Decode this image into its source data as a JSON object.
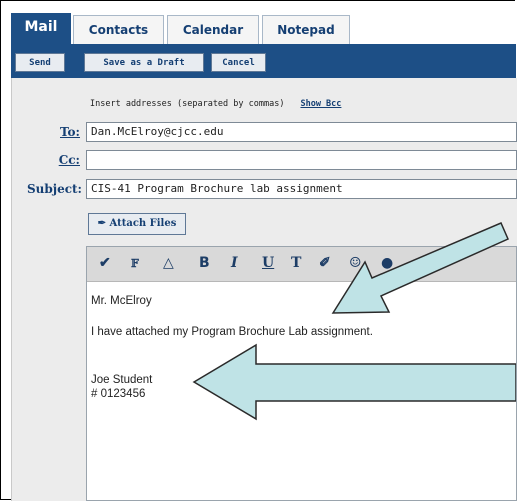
{
  "tabs": [
    {
      "label": "Mail",
      "active": true
    },
    {
      "label": "Contacts",
      "active": false
    },
    {
      "label": "Calendar",
      "active": false
    },
    {
      "label": "Notepad",
      "active": false
    }
  ],
  "toolbar": {
    "send_label": "Send",
    "draft_label": "Save as a Draft",
    "cancel_label": "Cancel"
  },
  "compose": {
    "hint": "Insert addresses (separated by commas)",
    "show_bcc": "Show Bcc",
    "to_label": "To:",
    "to_value": "Dan.McElroy@cjcc.edu",
    "cc_label": "Cc:",
    "cc_value": "",
    "subject_label": "Subject:",
    "subject_value": "CIS-41 Program Brochure lab assignment",
    "attach_label": "Attach Files"
  },
  "editor": {
    "toolbar_icons": [
      "spell-check-icon",
      "font-face-icon",
      "font-size-icon",
      "bold-icon",
      "italic-icon",
      "underline-icon",
      "text-color-icon",
      "highlight-icon",
      "emoticon-icon",
      "more-icon"
    ],
    "body_lines": [
      "Mr. McElroy",
      "I have attached my Program Brochure Lab assignment.",
      "Joe Student",
      "# 0123456"
    ]
  },
  "colors": {
    "header_blue": "#1d4f86",
    "panel_gray": "#ececec",
    "arrow_fill": "#bfe3e6"
  }
}
